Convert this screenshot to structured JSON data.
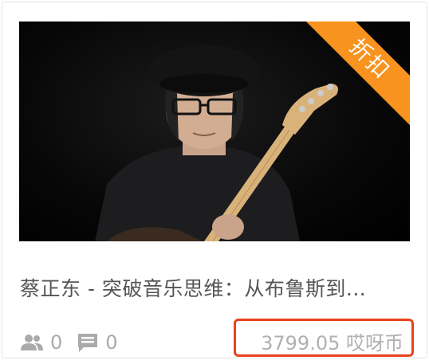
{
  "card": {
    "badge": "折扣",
    "title": "蔡正东 - 突破音乐思维：从布鲁斯到...",
    "students_count": "0",
    "comments_count": "0",
    "price": "3799.05 哎呀币"
  },
  "icons": {
    "students": "people-icon",
    "comments": "comment-icon"
  },
  "colors": {
    "badge": "#f7931e",
    "highlight_border": "#e8431e",
    "text": "#555555",
    "muted": "#aaaaaa"
  }
}
